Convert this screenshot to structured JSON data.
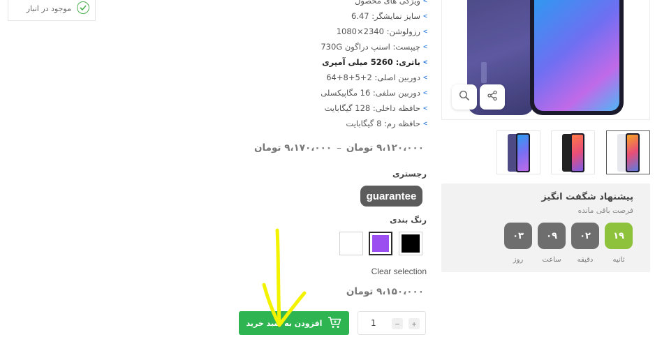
{
  "stock": {
    "text": "موجود در انبار"
  },
  "specs": [
    {
      "text": "ویژگی های محصول",
      "bold": false
    },
    {
      "text": "سایز نمایشگر: 6.47",
      "bold": false
    },
    {
      "text": "رزولوشن: 2340×1080",
      "bold": false
    },
    {
      "text": "چیپست: اسنپ دراگون 730G",
      "bold": false
    },
    {
      "text": "باتری: 5260 میلی آمپری",
      "bold": true
    },
    {
      "text": "دوربین اصلی: 2+5+8+64",
      "bold": false
    },
    {
      "text": "دوربین سلفی: 16 مگاپیکسلی",
      "bold": false
    },
    {
      "text": "حافظه داخلی: 128 گیگابایت",
      "bold": false
    },
    {
      "text": "حافظه رم: 8 گیگابایت",
      "bold": false
    }
  ],
  "price": {
    "min": "۹،۱۲۰،۰۰۰ تومان",
    "separator": "–",
    "max": "۹،۱۷۰،۰۰۰ تومان",
    "selected": "۹،۱۵۰،۰۰۰ تومان"
  },
  "registry": {
    "label": "رجستری",
    "option": "guarantee"
  },
  "colors": {
    "label": "رنگ بندی",
    "swatches": [
      {
        "name": "black",
        "color": "#000000",
        "selected": false
      },
      {
        "name": "purple",
        "color": "#9b4ff0",
        "selected": true
      },
      {
        "name": "white",
        "color": "#ffffff",
        "selected": false
      }
    ],
    "clear_label": "Clear selection"
  },
  "cart": {
    "quantity": "1",
    "plus": "+",
    "minus": "−",
    "add_label": "افزودن به سبد خرید"
  },
  "deal": {
    "title": "پیشنهاد شگفت انگیز",
    "subtitle": "فرصت باقی مانده",
    "timer": [
      {
        "value": "۱۹",
        "label": "ثانیه"
      },
      {
        "value": "۰۲",
        "label": "دقیقه"
      },
      {
        "value": "۰۹",
        "label": "ساعت"
      },
      {
        "value": "۰۳",
        "label": "روز"
      }
    ]
  },
  "theme": {
    "accent_green": "#2fb452",
    "timer_accent": "#8fc23c",
    "link_blue": "#1e6fd9",
    "annotation_yellow": "#f3f300"
  }
}
